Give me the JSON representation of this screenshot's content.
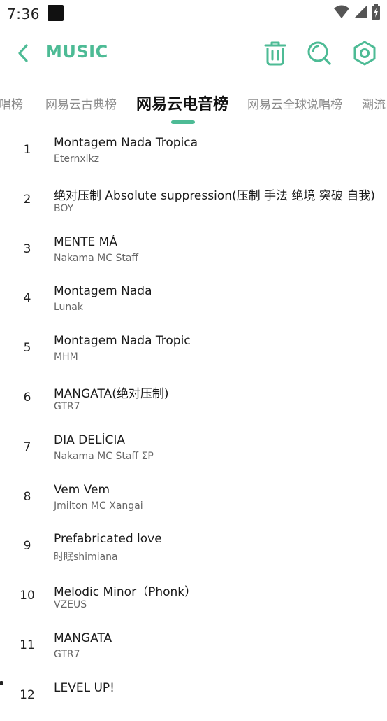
{
  "status_bar": {
    "time": "7:36"
  },
  "app_bar": {
    "title": "MUSIC"
  },
  "tabs": [
    {
      "label": "说唱榜"
    },
    {
      "label": "网易云古典榜"
    },
    {
      "label": "网易云电音榜"
    },
    {
      "label": "网易云全球说唱榜"
    },
    {
      "label": "潮流"
    }
  ],
  "active_tab_index": 2,
  "songs": [
    {
      "rank": "1",
      "title": "Montagem Nada Tropica",
      "artist": "Eternxlkz"
    },
    {
      "rank": "2",
      "title": "绝对压制 Absolute suppression(压制 手法 绝境 突破 自我)",
      "artist": "BOY"
    },
    {
      "rank": "3",
      "title": "MENTE MÁ",
      "artist": "Nakama MC Staff"
    },
    {
      "rank": "4",
      "title": "Montagem Nada",
      "artist": "Lunak"
    },
    {
      "rank": "5",
      "title": "Montagem Nada Tropic",
      "artist": "MHM"
    },
    {
      "rank": "6",
      "title": "MANGATA(绝对压制)",
      "artist": "GTR7"
    },
    {
      "rank": "7",
      "title": "DIA DELÍCIA",
      "artist": "Nakama MC Staff ΣP"
    },
    {
      "rank": "8",
      "title": "Vem Vem",
      "artist": "Jmilton MC Xangai"
    },
    {
      "rank": "9",
      "title": "Prefabricated love",
      "artist": "时眠shimiana"
    },
    {
      "rank": "10",
      "title": "Melodic Minor（Phonk）",
      "artist": "VZEUS"
    },
    {
      "rank": "11",
      "title": "MANGATA",
      "artist": "GTR7"
    },
    {
      "rank": "12",
      "title": "LEVEL UP!",
      "artist": ""
    }
  ],
  "colors": {
    "accent": "#4dbb95",
    "text": "#1a1a1a",
    "subtext": "#666666"
  }
}
